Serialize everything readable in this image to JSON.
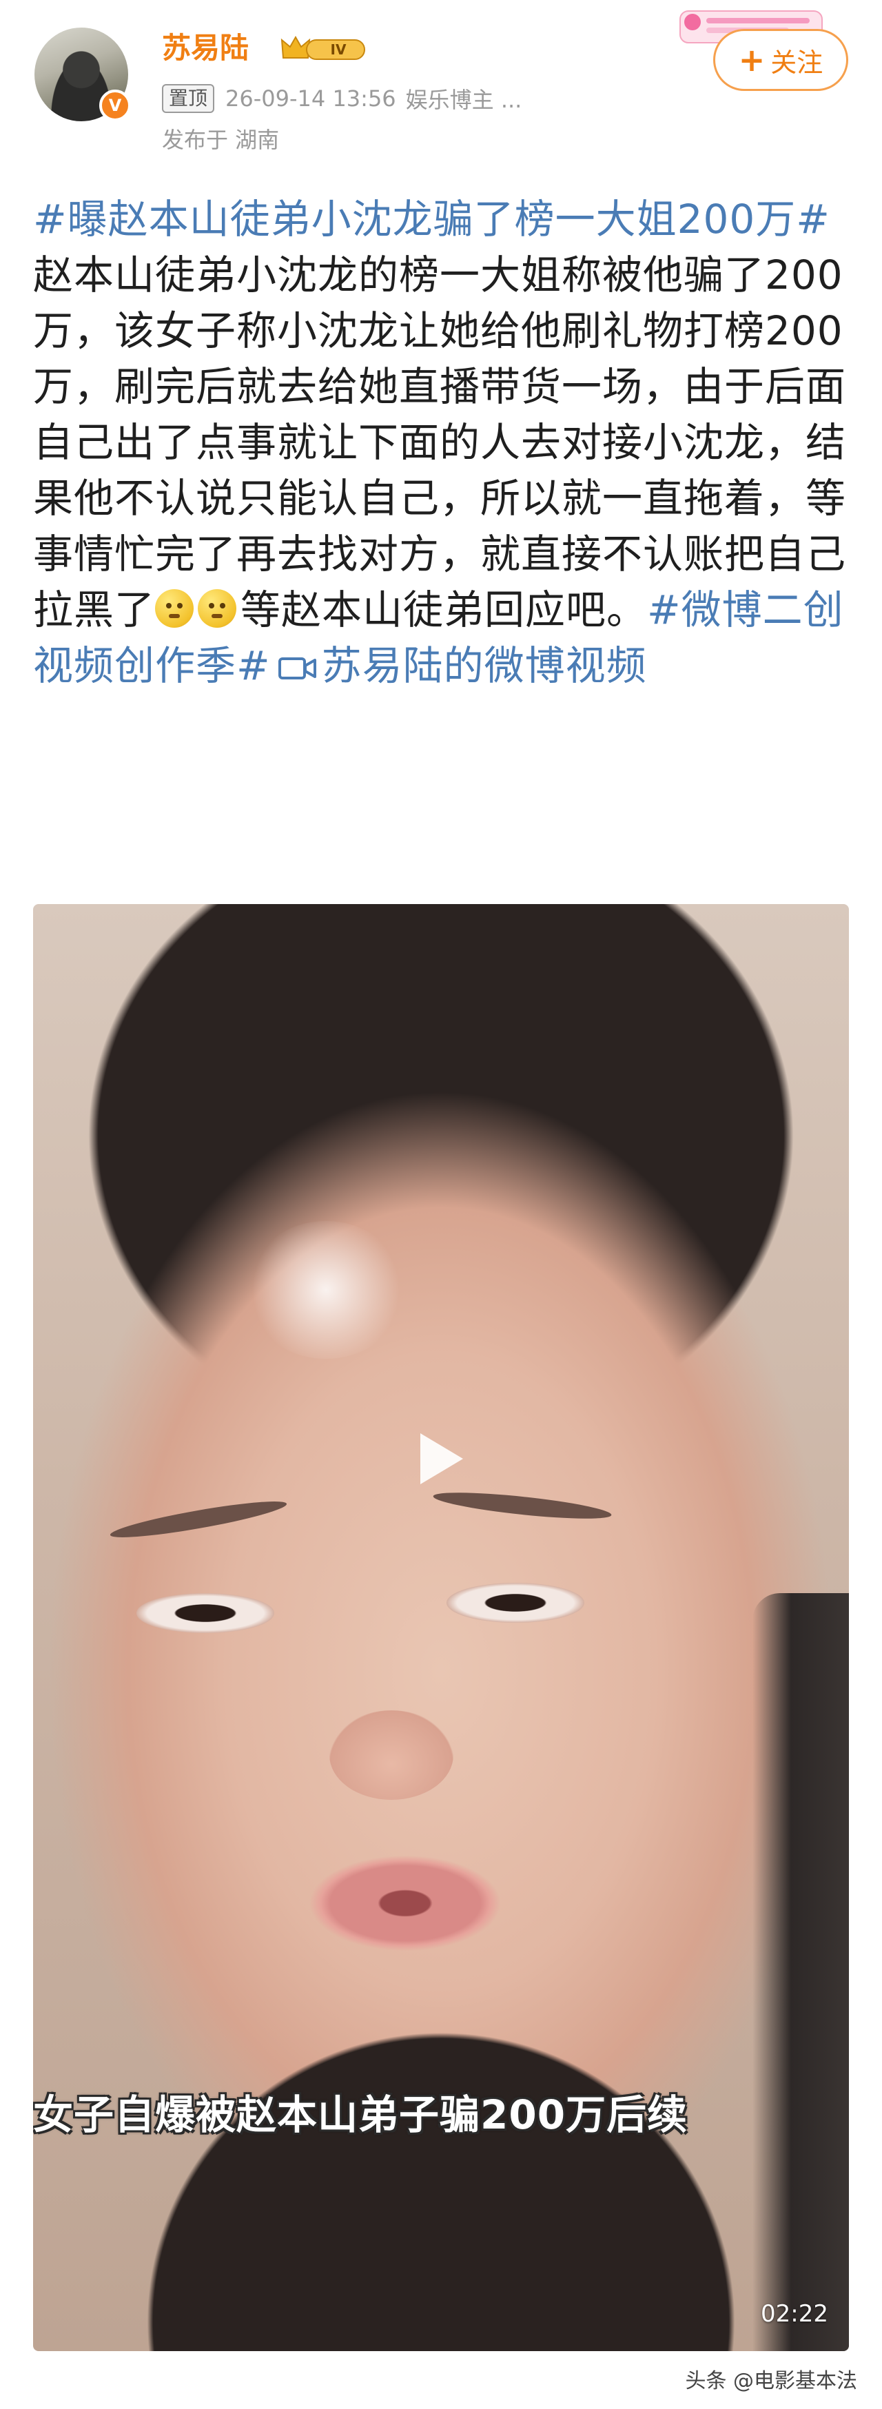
{
  "author": {
    "name": "苏易陆",
    "level_badge": "IV",
    "pinned_label": "置顶",
    "timestamp": "26-09-14 13:56",
    "title": "娱乐博主 ...",
    "location": "发布于 湖南",
    "verified_badge": "V"
  },
  "follow_button": {
    "plus": "+",
    "label": "关注"
  },
  "post": {
    "hashtag_1": "#曝赵本山徒弟小沈龙骗了榜一大姐200万#",
    "body": "赵本山徒弟小沈龙的榜一大姐称被他骗了200万，该女子称小沈龙让她给他刷礼物打榜200万，刷完后就去给她直播带货一场，由于后面自己出了点事就让下面的人去对接小沈龙，结果他不认说只能认自己，所以就一直拖着，等事情忙完了再去找对方，就直接不认账把自己拉黑了",
    "after_emoji": "等赵本山徒弟回应吧。",
    "hashtag_2": "#微博二创视频创作季#",
    "video_link": "苏易陆的微博视频"
  },
  "video": {
    "subtitle": "女子自爆被赵本山弟子骗200万后续",
    "duration": "02:22"
  },
  "watermark": "头条 @电影基本法",
  "colors": {
    "username": "#f07f13",
    "hashtag": "#4a7cb5",
    "follow_border": "#f6a04d"
  },
  "icons": [
    "verified-v-icon",
    "vip-crown-icon",
    "emoji-thinking-icon",
    "video-camera-icon",
    "play-icon"
  ]
}
